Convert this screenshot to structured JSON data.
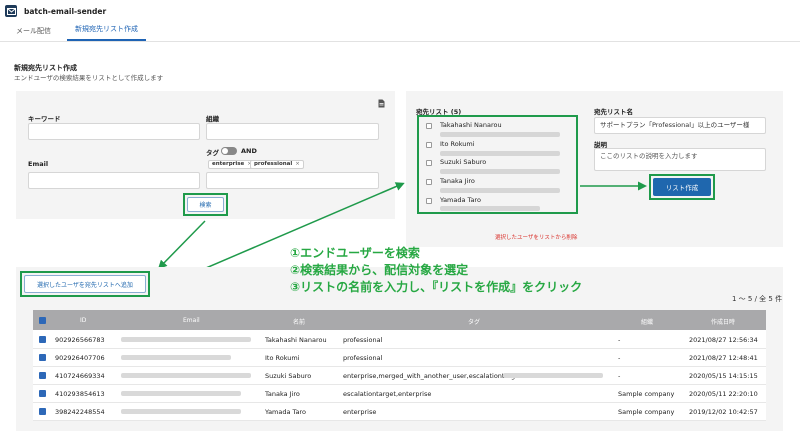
{
  "app": {
    "title": "batch-email-sender"
  },
  "tabs": [
    {
      "label": "メール配信"
    },
    {
      "label": "新規宛先リスト作成"
    }
  ],
  "section": {
    "title": "新規宛先リスト作成",
    "subtitle": "エンドユーザの検索結果をリストとして作成します"
  },
  "search": {
    "keyword_label": "キーワード",
    "org_label": "組織",
    "email_label": "Email",
    "tag_label": "タグ",
    "and_label": "AND",
    "tags": [
      "enterprise",
      "professional"
    ],
    "search_button": "検索",
    "add_button": "選択したユーザを宛先リストへ追加"
  },
  "recipients": {
    "heading": "宛先リスト (5)",
    "items": [
      {
        "name": "Takahashi Nanarou"
      },
      {
        "name": "Ito Rokumi"
      },
      {
        "name": "Suzuki Saburo"
      },
      {
        "name": "Tanaka Jiro"
      },
      {
        "name": "Yamada Taro"
      }
    ],
    "delete_link": "選択したユーザをリストから削除"
  },
  "list_form": {
    "name_label": "宛先リスト名",
    "name_value": "サポートプラン「Professional」以上のユーザー様",
    "desc_label": "説明",
    "desc_placeholder": "ここのリストの説明を入力します",
    "create_button": "リスト作成"
  },
  "instructions": [
    "①エンドユーザーを検索",
    "②検索結果から、配信対象を選定",
    "③リストの名前を入力し、『リストを作成』をクリック"
  ],
  "table": {
    "pagination": "1 〜 5 / 全 5 件",
    "columns": [
      "ID",
      "Email",
      "名前",
      "タグ",
      "組織",
      "作成日時"
    ],
    "rows": [
      {
        "id": "902926566783",
        "name": "Takahashi Nanarou",
        "tags": "professional",
        "org": "-",
        "created": "2021/08/27 12:56:34"
      },
      {
        "id": "902926407706",
        "name": "Ito Rokumi",
        "tags": "professional",
        "org": "-",
        "created": "2021/08/27 12:48:41"
      },
      {
        "id": "410724669334",
        "name": "Suzuki Saburo",
        "tags": "enterprise,merged_with_another_user,escalationtarget",
        "org": "-",
        "created": "2020/05/15 14:15:15"
      },
      {
        "id": "410293854613",
        "name": "Tanaka Jiro",
        "tags": "escalationtarget,enterprise",
        "org": "Sample company",
        "created": "2020/05/11 22:20:10"
      },
      {
        "id": "398242248554",
        "name": "Yamada Taro",
        "tags": "enterprise",
        "org": "Sample company",
        "created": "2019/12/02 10:42:57"
      }
    ]
  },
  "colors": {
    "accent": "#1f67ae",
    "highlight": "#1f9a4b",
    "instruction": "#27a843",
    "danger": "#d9312b"
  }
}
